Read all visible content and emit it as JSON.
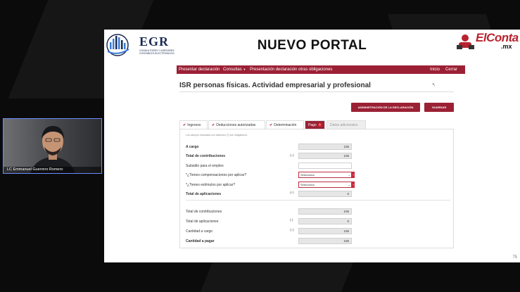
{
  "slide": {
    "title": "NUEVO PORTAL",
    "logo_left": {
      "name": "EGR",
      "subtitle": "CONSULTORES Y ASESORES CONTABLES ELECTRONICOS"
    },
    "logo_right": {
      "name": "ElConta",
      "domain": ".mx"
    },
    "page_number": "75"
  },
  "navbar": {
    "items": [
      "Presentar declaración",
      "Consultas",
      "Presentación declaración otras obligaciones"
    ],
    "right_items": [
      "Inicio",
      "Cerrar"
    ]
  },
  "page": {
    "heading": "ISR personas físicas. Actividad empresarial y profesional",
    "buttons": {
      "admin": "ADMINISTRACIÓN DE LA DECLARACIÓN",
      "save": "GUARDAR"
    }
  },
  "tabs": [
    {
      "label": "Ingresos",
      "state": "checked"
    },
    {
      "label": "Deducciones autorizadas",
      "state": "checked"
    },
    {
      "label": "Determinación",
      "state": "checked"
    },
    {
      "label": "Pago",
      "state": "active",
      "badge": "1"
    },
    {
      "label": "Datos adicionales",
      "state": "disabled"
    }
  ],
  "form": {
    "note": "Los campos marcados con asterisco (*) son obligatorios.",
    "rows": [
      {
        "label": "A cargo",
        "sign": "",
        "value": "106",
        "bold": true
      },
      {
        "label": "Total de contribuciones",
        "sign": "(=)",
        "value": "106",
        "bold": true
      },
      {
        "label": "Subsidio para el empleo",
        "sign": "",
        "value": "",
        "bold": false
      },
      {
        "label": "*¿Tienes compensaciones por aplicar?",
        "sign": "",
        "select": "Selecciona",
        "bold": false
      },
      {
        "label": "*¿Tienes estímulos por aplicar?",
        "sign": "",
        "select": "Selecciona",
        "bold": false
      },
      {
        "label": "Total de aplicaciones",
        "sign": "(+)",
        "value": "0",
        "bold": true
      }
    ],
    "summary": [
      {
        "label": "Total de contribuciones",
        "sign": "",
        "value": "106",
        "bold": false
      },
      {
        "label": "Total de aplicaciones",
        "sign": "(-)",
        "value": "0",
        "bold": false
      },
      {
        "label": "Cantidad a cargo",
        "sign": "(=)",
        "value": "106",
        "bold": false
      },
      {
        "label": "Cantidad a pagar",
        "sign": "",
        "value": "106",
        "bold": true
      }
    ]
  },
  "webcam": {
    "name": "LC Emmanuel Guerrero Romero"
  },
  "colors": {
    "brand": "#9b2034",
    "background": "#0b0b0b"
  }
}
